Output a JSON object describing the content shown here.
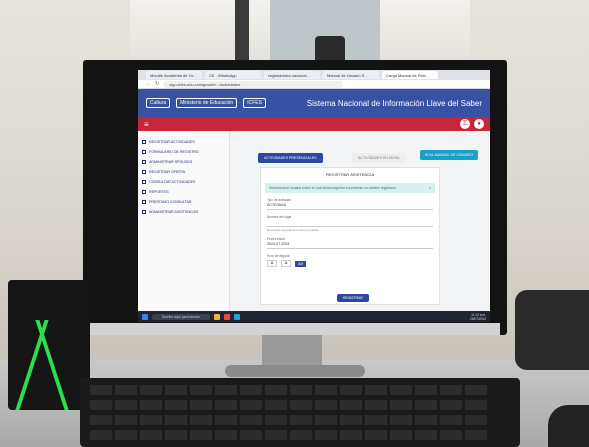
{
  "browser": {
    "tabs": [
      {
        "label": "Moodle Academia de Yo..."
      },
      {
        "label": "CE - WhatsApp"
      },
      {
        "label": "registraduría.nacional..."
      },
      {
        "label": "Manual de Usuario S..."
      },
      {
        "label": "Carga Manual de Plan..."
      }
    ],
    "address": "sigo.icfes.edu.co/sigoweb/.../actividades"
  },
  "header": {
    "logo_1": "Cultura",
    "logo_2": "Ministerio de Educación",
    "logo_3": "ICFES",
    "site_title": "Sistema Nacional de Información Llave del Saber"
  },
  "sidebar": {
    "items": [
      {
        "label": "REGISTRAR ACTIVIDADES"
      },
      {
        "label": "FORMULARIO DE REGISTRO"
      },
      {
        "label": "ADMINISTRAR SPOUSES"
      },
      {
        "label": "REGISTRAR OFERTA"
      },
      {
        "label": "CONSULTAR ACTIVIDADES"
      },
      {
        "label": "REPORTES"
      },
      {
        "label": "PRESTAMO CONSULTAR"
      },
      {
        "label": "ADMINISTRAR ASISTENCIAS"
      }
    ]
  },
  "main": {
    "tab_presencial": "ACTIVIDADES PRESENCIALES",
    "tab_virtual": "ACTIVIDADES EN MOVIL",
    "manual_button": "IR AL MANUAL DE USUARIO",
    "panel_title": "REGISTRAR ASISTENCIA",
    "alert_text": "Selecciona el usuario sobre el cual desea registrar el presente, no olvides registrarlo.",
    "alert_close": "×",
    "field1_label": "Tipo de actividad",
    "field1_value": "ACTIVIDAD",
    "field2_label": "Nombre del lugar",
    "field2_note": "Recuerda ingresar el nombre completo",
    "field3_label": "Fecha inicial",
    "field3_value": "2024-07-2024",
    "time_label": "Hora de llegada",
    "hour": "11",
    "minute": "11",
    "ampm": "AM",
    "save_button": "REGISTRAR"
  },
  "taskbar": {
    "search_placeholder": "Escribe aquí para buscar",
    "time": "11:12 a.m.",
    "date": "25/07/2024"
  }
}
